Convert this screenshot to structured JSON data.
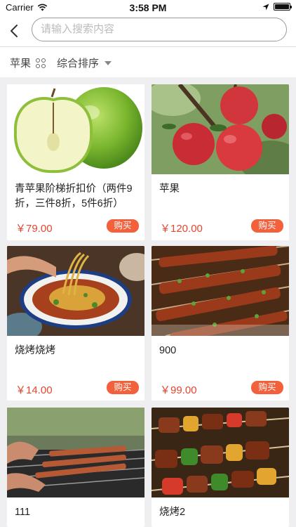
{
  "status_bar": {
    "carrier": "Carrier",
    "time": "3:58 PM",
    "icons": [
      "wifi-icon",
      "location-icon",
      "battery-icon"
    ]
  },
  "header": {
    "search_placeholder": "请输入搜索内容"
  },
  "filters": {
    "category": "苹果",
    "sort": "综合排序"
  },
  "products": [
    {
      "title": "青苹果阶梯折扣价（两件9折，三件8折，5件6折）",
      "price": "￥79.00",
      "buy": "购买"
    },
    {
      "title": "苹果",
      "price": "￥120.00",
      "buy": "购买"
    },
    {
      "title": "烧烤烧烤",
      "price": "￥14.00",
      "buy": "购买"
    },
    {
      "title": "900",
      "price": "￥99.00",
      "buy": "购买"
    },
    {
      "title": "111",
      "price": "",
      "buy": ""
    },
    {
      "title": "烧烤2",
      "price": "",
      "buy": ""
    }
  ],
  "colors": {
    "price": "#e6452f",
    "buy_button": "#f2613b",
    "background": "#efeff1"
  }
}
